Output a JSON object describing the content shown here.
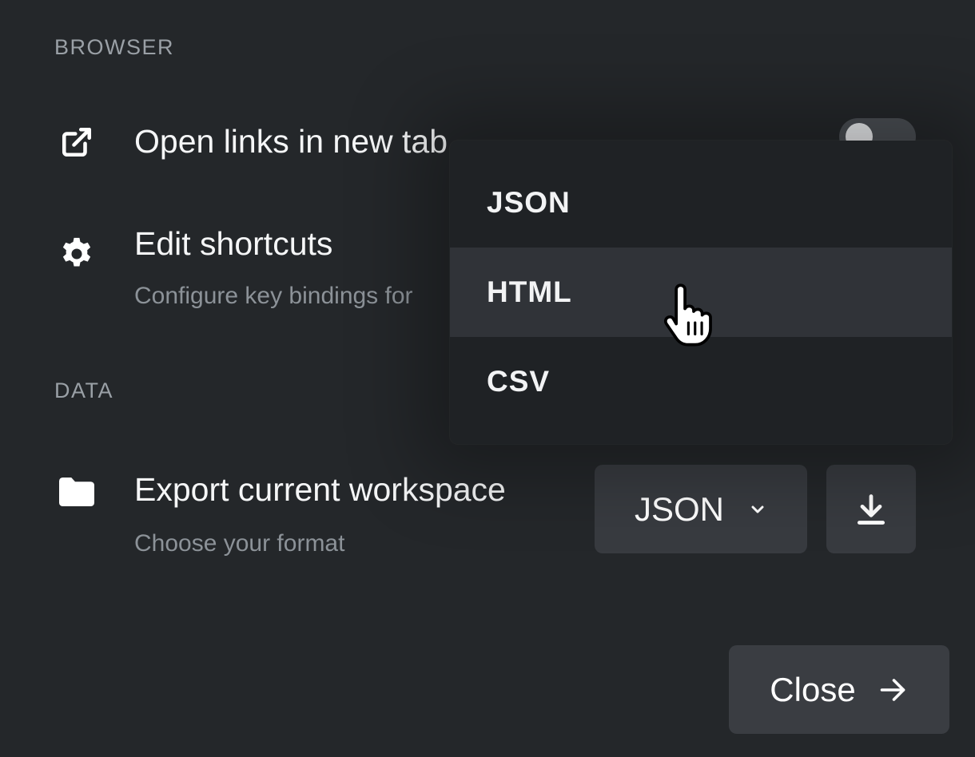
{
  "sections": {
    "browser_label": "BROWSER",
    "data_label": "DATA"
  },
  "settings": {
    "open_links": {
      "title": "Open links in new tab",
      "icon": "external-link-icon",
      "toggle_on": false
    },
    "shortcuts": {
      "title": "Edit shortcuts",
      "description": "Configure key bindings for",
      "icon": "gear-icon"
    },
    "export": {
      "title": "Export current workspace",
      "description": "Choose your format",
      "icon": "folder-icon",
      "selected_format": "JSON"
    }
  },
  "dropdown": {
    "options": [
      "JSON",
      "HTML",
      "CSV"
    ],
    "hovered": "HTML"
  },
  "footer": {
    "close_label": "Close"
  },
  "colors": {
    "background": "#24272a",
    "button": "#383b40",
    "dropdown": "#1f2225",
    "muted_text": "#8c9298"
  }
}
